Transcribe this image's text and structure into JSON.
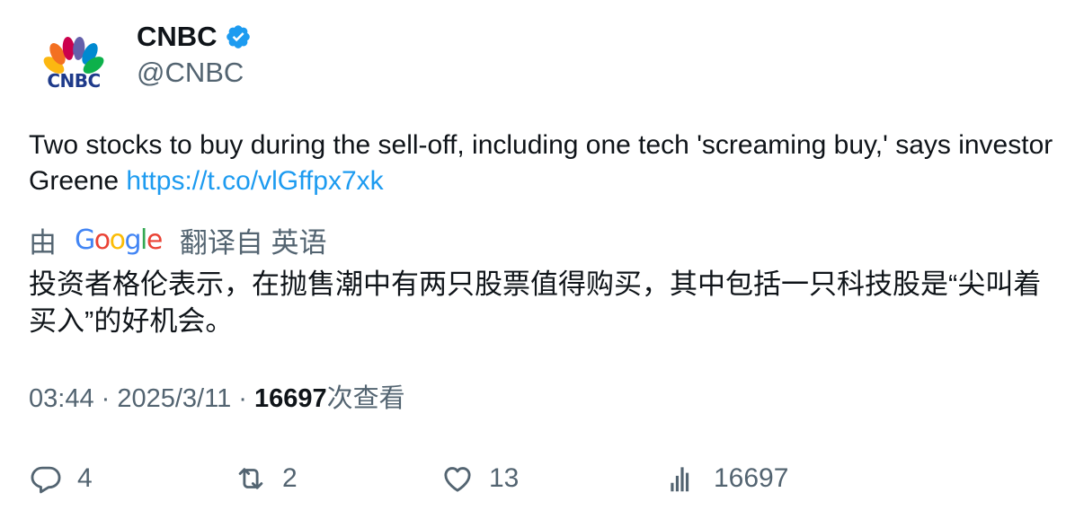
{
  "author": {
    "display_name": "CNBC",
    "handle": "@CNBC",
    "logo_text": "CNBC",
    "verified": true
  },
  "tweet": {
    "text": "Two stocks to buy during the sell-off, including one tech 'screaming buy,' says investor Greene ",
    "link": "https://t.co/vlGffpx7xk"
  },
  "translation": {
    "prefix": "由",
    "provider_letters": [
      {
        "ch": "G",
        "color": "#4285F4"
      },
      {
        "ch": "o",
        "color": "#EA4335"
      },
      {
        "ch": "o",
        "color": "#FBBC05"
      },
      {
        "ch": "g",
        "color": "#4285F4"
      },
      {
        "ch": "l",
        "color": "#34A853"
      },
      {
        "ch": "e",
        "color": "#EA4335"
      }
    ],
    "suffix": "翻译自 英语",
    "text": "投资者格伦表示，在抛售潮中有两只股票值得购买，其中包括一只科技股是“尖叫着买入”的好机会。"
  },
  "meta": {
    "time": "03:44",
    "sep1": " · ",
    "date": "2025/3/11",
    "sep2": " · ",
    "views": "16697",
    "views_label": "次查看"
  },
  "actions": {
    "replies": "4",
    "retweets": "2",
    "likes": "13",
    "views": "16697"
  },
  "colors": {
    "link": "#1d9bf0",
    "verified": "#1d9bf0",
    "secondary_text": "#536471",
    "primary_text": "#0f1419"
  }
}
